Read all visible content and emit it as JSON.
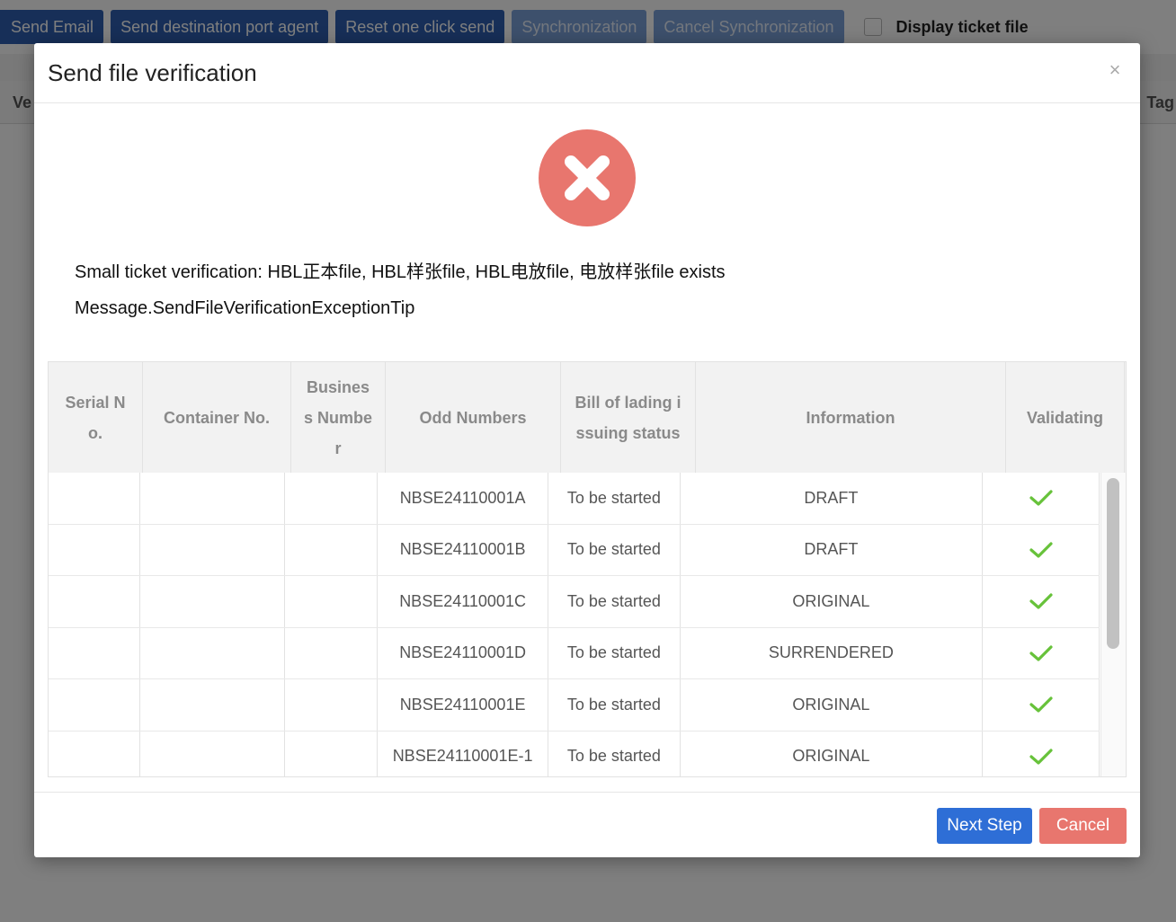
{
  "toolbar": {
    "send_email": "Send Email",
    "send_agent": "Send destination port agent",
    "reset_send": "Reset one click send",
    "sync": "Synchronization",
    "cancel_sync": "Cancel Synchronization",
    "display_ticket": "Display ticket file"
  },
  "bg_header": {
    "left": "Ve",
    "right": "Tag"
  },
  "modal": {
    "title": "Send file verification",
    "close": "×",
    "message1": "Small ticket verification: HBL正本file, HBL样张file, HBL电放file, 电放样张file exists",
    "message2": "Message.SendFileVerificationExceptionTip",
    "next_label": "Next Step",
    "cancel_label": "Cancel"
  },
  "table": {
    "columns": [
      "Serial No.",
      "Container No.",
      "Business Number",
      "Odd Numbers",
      "Bill of lading issuing status",
      "Information",
      "Validating"
    ],
    "rows": [
      {
        "serial": "",
        "container": "",
        "business": "",
        "odd": "NBSE24110001A",
        "status": "To be started",
        "info": "DRAFT",
        "valid": true
      },
      {
        "serial": "",
        "container": "",
        "business": "",
        "odd": "NBSE24110001B",
        "status": "To be started",
        "info": "DRAFT",
        "valid": true
      },
      {
        "serial": "",
        "container": "",
        "business": "",
        "odd": "NBSE24110001C",
        "status": "To be started",
        "info": "ORIGINAL",
        "valid": true
      },
      {
        "serial": "",
        "container": "",
        "business": "",
        "odd": "NBSE24110001D",
        "status": "To be started",
        "info": "SURRENDERED",
        "valid": true
      },
      {
        "serial": "",
        "container": "",
        "business": "",
        "odd": "NBSE24110001E",
        "status": "To be started",
        "info": "ORIGINAL",
        "valid": true
      },
      {
        "serial": "",
        "container": "",
        "business": "",
        "odd": "NBSE24110001E-1",
        "status": "To be started",
        "info": "ORIGINAL",
        "valid": true
      }
    ]
  },
  "colors": {
    "primary": "#2e6ed6",
    "danger": "#e8766e",
    "success": "#67c23a"
  },
  "icons": {
    "error": "x-circle-icon",
    "valid": "check-icon",
    "close": "close-icon"
  }
}
